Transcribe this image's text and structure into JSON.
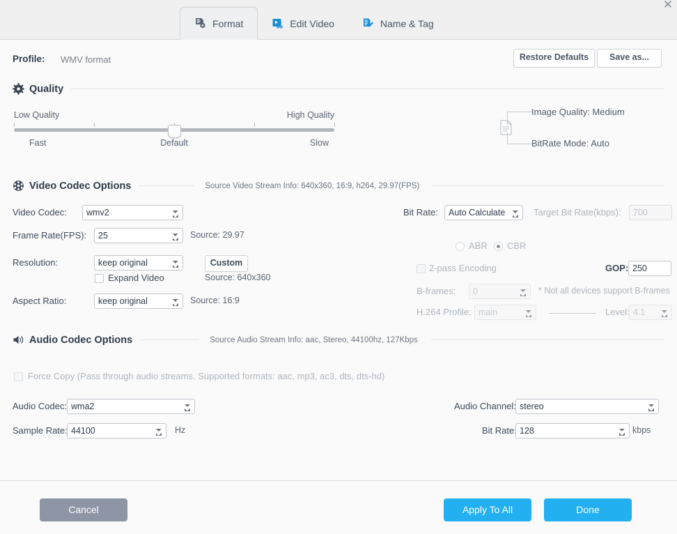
{
  "window": {
    "close_label": "✕"
  },
  "tabs": [
    {
      "id": "format",
      "label": "Format",
      "icon": "document-gear-icon",
      "active": true
    },
    {
      "id": "edit-video",
      "label": "Edit Video",
      "icon": "scissors-video-icon",
      "active": false
    },
    {
      "id": "name-tag",
      "label": "Name & Tag",
      "icon": "document-pencil-icon",
      "active": false
    }
  ],
  "profile": {
    "label": "Profile:",
    "value": "WMV format",
    "restore_defaults": "Restore Defaults",
    "save_as": "Save as..."
  },
  "quality": {
    "title": "Quality",
    "icon": "gear-icon",
    "low_label": "Low Quality",
    "high_label": "High Quality",
    "fast_label": "Fast",
    "default_label": "Default",
    "slow_label": "Slow",
    "slider_value": 50,
    "image_quality": "Image Quality: Medium",
    "bitrate_mode": "BitRate Mode: Auto"
  },
  "video": {
    "title": "Video Codec Options",
    "icon": "film-reel-icon",
    "source_info": "Source Video Stream Info: 640x360, 16:9, h264, 29.97(FPS)",
    "video_codec_label": "Video Codec:",
    "video_codec_value": "wmv2",
    "frame_rate_label": "Frame Rate(FPS):",
    "frame_rate_value": "25",
    "frame_rate_source": "Source: 29.97",
    "resolution_label": "Resolution:",
    "resolution_value": "keep original",
    "custom_button": "Custom",
    "expand_video_label": "Expand Video",
    "expand_video_checked": false,
    "resolution_source": "Source: 640x360",
    "aspect_ratio_label": "Aspect Ratio:",
    "aspect_ratio_value": "keep original",
    "aspect_ratio_source": "Source: 16:9",
    "bit_rate_label": "Bit Rate:",
    "bit_rate_value": "Auto Calculate",
    "target_bit_rate_label": "Target Bit Rate(kbps):",
    "target_bit_rate_placeholder": "700",
    "target_bit_rate_value": "",
    "abr_label": "ABR",
    "cbr_label": "CBR",
    "rate_mode_selected": "CBR",
    "two_pass_label": "2-pass Encoding",
    "two_pass_checked": false,
    "gop_label": "GOP:",
    "gop_value": "250",
    "bframes_label": "B-frames:",
    "bframes_value": "0",
    "bframes_note": "* Not all devices support B-frames",
    "h264_profile_label": "H.264 Profile:",
    "h264_profile_value": "main",
    "level_label": "Level:",
    "level_value": "4.1"
  },
  "audio": {
    "title": "Audio Codec Options",
    "icon": "speaker-icon",
    "source_info": "Source Audio Stream Info: aac, Stereo, 44100hz, 127Kbps",
    "force_copy_label": "Force Copy (Pass through audio streams. Supported formats: aac, mp3, ac3, dts, dts-hd)",
    "force_copy_checked": false,
    "audio_codec_label": "Audio Codec:",
    "audio_codec_value": "wma2",
    "sample_rate_label": "Sample Rate:",
    "sample_rate_value": "44100",
    "sample_rate_unit": "Hz",
    "audio_channel_label": "Audio Channel:",
    "audio_channel_value": "stereo",
    "bit_rate_label": "Bit Rate:",
    "bit_rate_value": "128",
    "bit_rate_unit": "kbps"
  },
  "footer": {
    "cancel": "Cancel",
    "apply_to_all": "Apply To All",
    "done": "Done"
  },
  "colors": {
    "accent_blue": "#23b0f0",
    "cancel_gray": "#8e95a5",
    "tab_icon_blue": "#1a8fd6",
    "background": "#fafafa"
  }
}
